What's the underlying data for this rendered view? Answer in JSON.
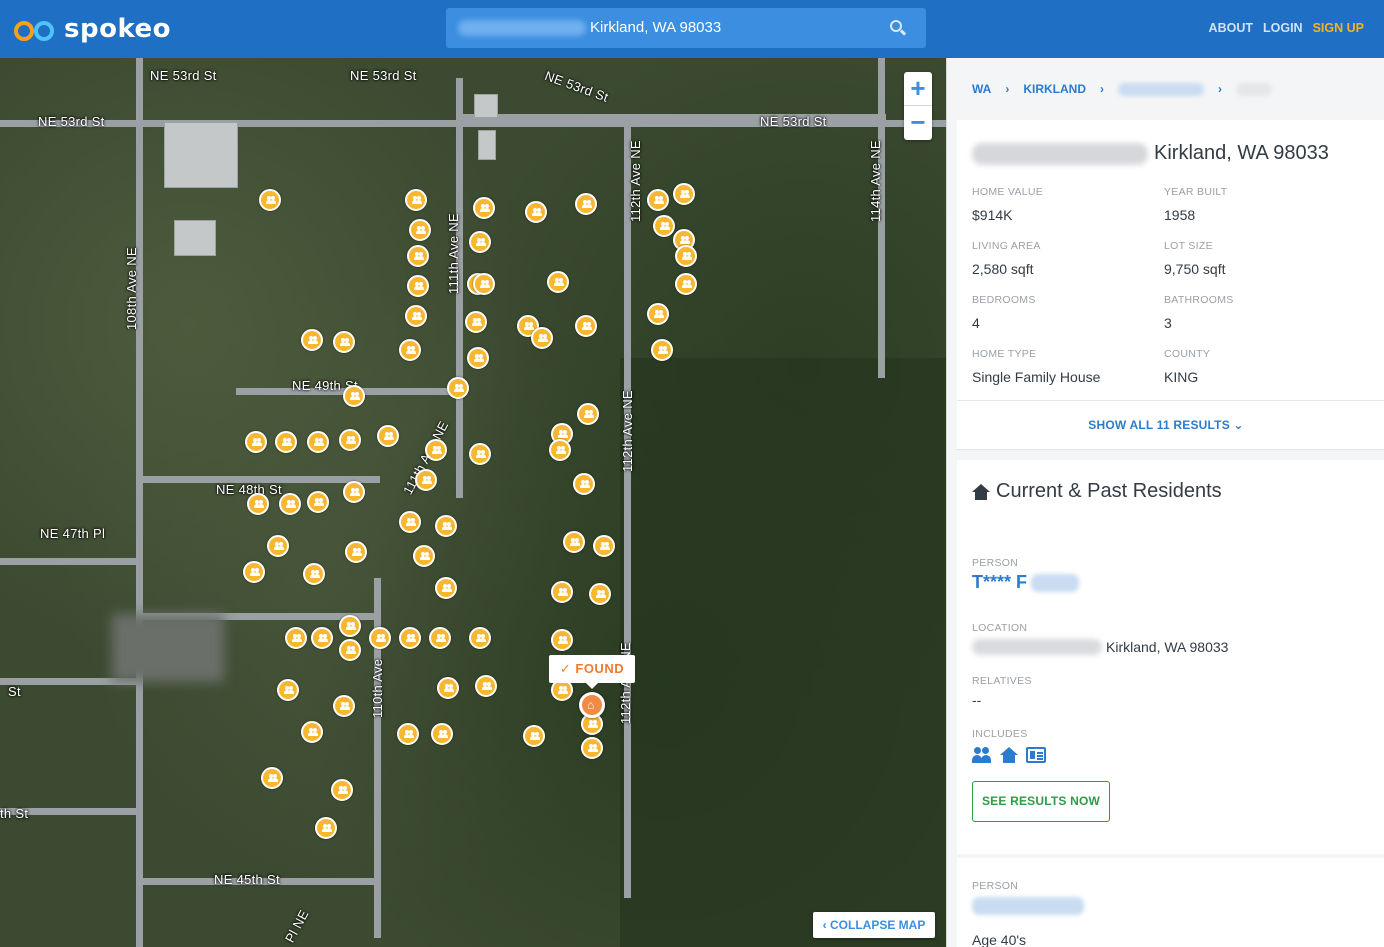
{
  "header": {
    "logo_text": "spokeo",
    "search_value": "Kirkland, WA 98033",
    "nav": {
      "about": "ABOUT",
      "login": "LOGIN",
      "signup": "SIGN UP"
    }
  },
  "map": {
    "streets": {
      "ne53_a": "NE 53rd St",
      "ne53_b": "NE 53rd St",
      "ne53_c": "NE 53rd St",
      "ne53_d": "NE 53rd St",
      "ne53_e": "NE 53rd St",
      "ne49": "NE 49th St",
      "ne48": "NE 48th St",
      "ne47": "NE 47th Pl",
      "ne45": "NE 45th St",
      "ave108": "108th Ave NE",
      "ave111a": "111th Ave NE",
      "ave111b": "111th Ave NE",
      "ave112a": "112th Ave NE",
      "ave112b": "112th Ave NE",
      "ave112c": "112th Ave NE",
      "ave114": "114th Ave NE",
      "ave110": "110th Ave",
      "st_left": "St",
      "th_st": "th St",
      "pl_ne": "Pl NE"
    },
    "found_label": "✓ FOUND",
    "zoom_in": "+",
    "zoom_out": "−",
    "collapse_label": "‹ COLLAPSE MAP"
  },
  "sidebar": {
    "breadcrumb": {
      "state": "WA",
      "city": "KIRKLAND"
    },
    "address_suffix": "Kirkland, WA 98033",
    "properties": [
      {
        "label": "HOME VALUE",
        "value": "$914K"
      },
      {
        "label": "YEAR BUILT",
        "value": "1958"
      },
      {
        "label": "LIVING AREA",
        "value": "2,580 sqft"
      },
      {
        "label": "LOT SIZE",
        "value": "9,750 sqft"
      },
      {
        "label": "BEDROOMS",
        "value": "4"
      },
      {
        "label": "BATHROOMS",
        "value": "3"
      },
      {
        "label": "HOME TYPE",
        "value": "Single Family House"
      },
      {
        "label": "COUNTY",
        "value": "KING"
      }
    ],
    "show_all": "SHOW ALL 11 RESULTS ⌄",
    "residents": {
      "title": "Current & Past Residents",
      "person_label": "PERSON",
      "person_name": "T**** F",
      "location_label": "LOCATION",
      "location_value": "Kirkland, WA 98033",
      "relatives_label": "RELATIVES",
      "relatives_value": "--",
      "includes_label": "INCLUDES",
      "see_results": "SEE RESULTS NOW"
    },
    "person2": {
      "label": "PERSON",
      "age": "Age 40's"
    }
  },
  "colors": {
    "header": "#1f6fc5",
    "accent": "#2b7bd0",
    "marker": "#f7b733",
    "found": "#ef7b32",
    "cta": "#2e9b49"
  }
}
